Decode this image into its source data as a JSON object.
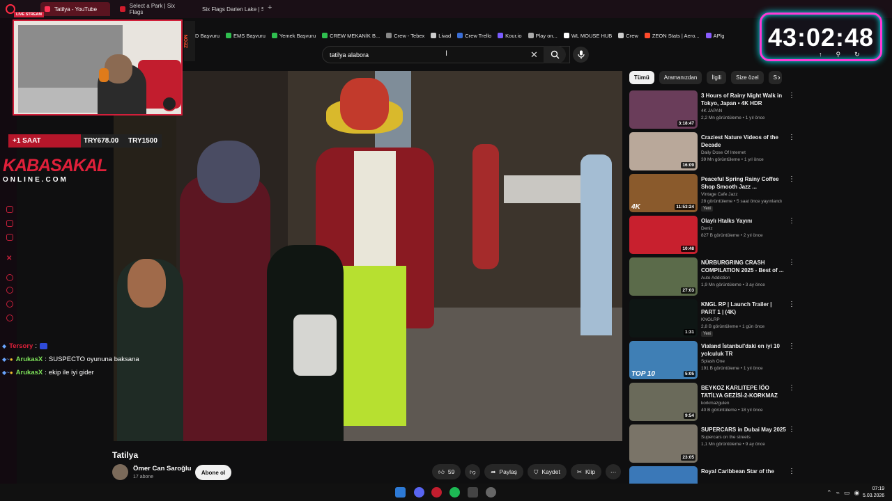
{
  "browser": {
    "tabs": [
      {
        "title": "Tatilya - YouTube",
        "active": true
      },
      {
        "title": "Select a Park | Six Flags",
        "active": false
      },
      {
        "title": "Six Flags Darien Lake | Sta",
        "active": false
      }
    ],
    "new_tab": "+"
  },
  "bookmarks": [
    {
      "label": "PD Başvuru",
      "color": "#2fbf4f"
    },
    {
      "label": "EMS Başvuru",
      "color": "#2fbf4f"
    },
    {
      "label": "Yemek Başvuru",
      "color": "#2fbf4f"
    },
    {
      "label": "CREW MEKANİK B...",
      "color": "#2fbf4f"
    },
    {
      "label": "Crew - Tebex",
      "color": "#888888"
    },
    {
      "label": "Livad",
      "color": "#cccccc"
    },
    {
      "label": "Crew Trello",
      "color": "#3b6ed6"
    },
    {
      "label": "Kour.io",
      "color": "#7a5cff"
    },
    {
      "label": "Play on...",
      "color": "#aaaaaa"
    },
    {
      "label": "WL MOUSE HUB",
      "color": "#ffffff"
    },
    {
      "label": "Crew",
      "color": "#cccccc"
    },
    {
      "label": "ZEON Stats | Aero...",
      "color": "#ff4a2b"
    },
    {
      "label": "APlg",
      "color": "#8a5cff"
    }
  ],
  "search": {
    "query": "tatilya alabora",
    "clear_icon": "close-icon",
    "search_icon": "search-icon",
    "mic_icon": "mic-icon"
  },
  "overlay": {
    "live_badge": "LIVE STREAM",
    "sponsor": "ZEON",
    "donation_label": "+1 SAAT",
    "donation_current": "TRY678.00",
    "donation_goal": "TRY1500",
    "brand_name": "KABASAKAL",
    "brand_sub": "ONLINE.COM",
    "timer": "43:02:48",
    "accent": "#d11f3a"
  },
  "chat": [
    {
      "user": "Tersory",
      "user_color": "#e0203a",
      "message": ""
    },
    {
      "user": "ArukasX",
      "user_color": "#7ee35a",
      "message": "SUSPECTO oyununa baksana"
    },
    {
      "user": "ArukasX",
      "user_color": "#7ee35a",
      "message": "ekip ile iyi gider"
    }
  ],
  "video": {
    "title": "Tatilya",
    "channel": "Ömer Can Saroğlu",
    "subscribers": "17 abone",
    "subscribe_label": "Abone ol",
    "likes": "59",
    "share_label": "Paylaş",
    "save_label": "Kaydet",
    "clip_label": "Klip",
    "more_label": "⋯"
  },
  "chips": [
    "Tümü",
    "Aramanızdan",
    "İlgili",
    "Size özel",
    "S"
  ],
  "recommendations": [
    {
      "title": "3 Hours of Rainy Night Walk in Tokyo, Japan • 4K HDR",
      "channel": "4K JAPAN",
      "meta": "2,2 Mn görüntüleme • 1 yıl önce",
      "duration": "3:18:47",
      "color": "#6a3d5a",
      "badge": "",
      "new": ""
    },
    {
      "title": "Craziest Nature Videos of the Decade",
      "channel": "Daily Dose Of Internet",
      "meta": "39 Mn görüntüleme • 1 yıl önce",
      "duration": "16:09",
      "color": "#b9a89a",
      "badge": "",
      "new": ""
    },
    {
      "title": "Peaceful Spring Rainy Coffee Shop Smooth Jazz ...",
      "channel": "Vintage Cafe Jazz",
      "meta": "28 görüntüleme • 5 saat önce yayınlandı",
      "duration": "11:53:24",
      "color": "#8a5a2c",
      "badge": "4K",
      "new": "Yeni"
    },
    {
      "title": "Olaylı Htalks Yayını",
      "channel": "Deniz",
      "meta": "827 B görüntüleme • 2 yıl önce",
      "duration": "10:48",
      "color": "#c8202e",
      "badge": "",
      "new": ""
    },
    {
      "title": "NÜRBURGRING CRASH COMPILATION 2025 - Best of ...",
      "channel": "Auto Addiction",
      "meta": "1,9 Mn görüntüleme • 3 ay önce",
      "duration": "27:03",
      "color": "#5b6b4a",
      "badge": "",
      "new": ""
    },
    {
      "title": "KNGL RP | Launch Trailer | PART 1 | (4K)",
      "channel": "KNGLRP",
      "meta": "2,8 B görüntüleme • 1 gün önce",
      "duration": "1:31",
      "color": "#0e1614",
      "badge": "",
      "new": "Yeni"
    },
    {
      "title": "Vialand İstanbul'daki en iyi 10 yolculuk TR",
      "channel": "Splash One",
      "meta": "191 B görüntüleme • 1 yıl önce",
      "duration": "5:05",
      "color": "#3f7fb5",
      "badge": "TOP 10",
      "new": ""
    },
    {
      "title": "BEYKOZ KARLITEPE İÖO TATİLYA GEZİSİ-2-KORKMAZ",
      "channel": "korkmazgulen",
      "meta": "40 B görüntüleme • 18 yıl önce",
      "duration": "9:54",
      "color": "#6a6a5a",
      "badge": "",
      "new": ""
    },
    {
      "title": "SUPERCARS in Dubai May 2025",
      "channel": "Supercars on the streets",
      "meta": "1,1 Mn görüntüleme • 9 ay önce",
      "duration": "23:05",
      "color": "#7a7468",
      "badge": "",
      "new": ""
    },
    {
      "title": "Royal Caribbean Star of the",
      "channel": "",
      "meta": "",
      "duration": "",
      "color": "#3a78b8",
      "badge": "",
      "new": ""
    }
  ],
  "taskbar": {
    "time": "07:19",
    "date": "5.03.2026"
  }
}
